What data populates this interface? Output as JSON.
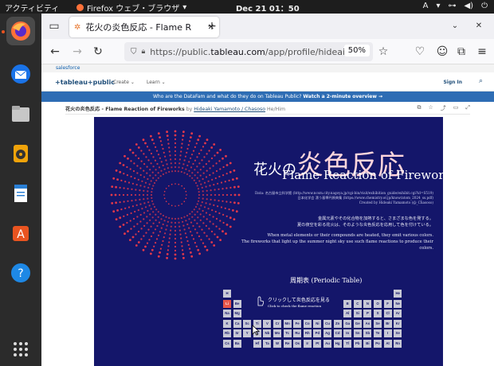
{
  "system": {
    "activities": "アクティビティ",
    "app_name": "Firefox ウェブ・ブラウザ",
    "clock": "Dec 21  01：50",
    "input_method": "A"
  },
  "browser": {
    "tab_title": "花火の炎色反応 - Flame R",
    "url_prefix": "https://public.",
    "url_host": "tableau.com",
    "url_path": "/app/profile/hideai",
    "zoom": "50%"
  },
  "site": {
    "salesforce": "salesforce",
    "logo": "+tableau+public",
    "menu_create": "Create ⌄",
    "menu_learn": "Learn ⌄",
    "sign_in": "Sign In",
    "banner_text": "Who are the DataFam and what do they do on Tableau Public?",
    "banner_link": "Watch a 2-minute overview →",
    "viz_title": "花火の炎色反応 - Flame Reaction of Fireworks",
    "by": "by",
    "author": "Hideaki Yamamoto / Chasoso",
    "author_tag": "He/Him"
  },
  "viz": {
    "title_jp_small": "花火の",
    "title_jp_big": "炎色反応",
    "title_en": "Flame Reaction of Fireworks",
    "source_lines": [
      "Data: 名古屋市立科学館 (http://www.ncsm.city.nagoya.jp/cgi-bin/visit/exhibition_guide/exhibit.cgi?id=S519)",
      "日本化学会 漂う基準円原典集 (https://www.chemistry.or.jp/know/atom_2024_ss.pdf)",
      "Created by Hideaki Yamamoto (@_Chasoso)"
    ],
    "desc_lines": [
      "金属元素やその化合物を加熱すると、さまざまな色を発する。",
      "夏の夜空を彩る花火は、そのような炎色反応を応用して色を付けている。",
      "When metal elements or their compounds are heated, they emit various colors.",
      "The fireworks that light up the summer night sky use such flame reactions to produce their colors."
    ],
    "periodic_title": "周期表 (Periodic Table)",
    "click_jp": "クリックして炎色反応を見る",
    "click_en": "Click to check the flame reaction",
    "firework_color": "#e83a4a",
    "background_color": "#14166a",
    "elements": {
      "row1": [
        "H",
        "",
        "He"
      ],
      "row2_left": [
        "Li",
        "Be"
      ],
      "row2_right": [
        "B",
        "C",
        "N",
        "O",
        "F",
        "Ne"
      ],
      "row3_left": [
        "Na",
        "Mg"
      ],
      "row3_right": [
        "Al",
        "Si",
        "P",
        "S",
        "Cl",
        "Ar"
      ],
      "row4": [
        "K",
        "Ca",
        "Sc",
        "Ti",
        "V",
        "Cr",
        "Mn",
        "Fe",
        "Co",
        "Ni",
        "Cu",
        "Zn",
        "Ga",
        "Ge",
        "As",
        "Se",
        "Br",
        "Kr"
      ],
      "row5": [
        "Rb",
        "Sr",
        "Y",
        "Zr",
        "Nb",
        "Mo",
        "Tc",
        "Ru",
        "Rh",
        "Pd",
        "Ag",
        "Cd",
        "In",
        "Sn",
        "Sb",
        "Te",
        "I",
        "Xe"
      ],
      "row6": [
        "Cs",
        "Ba",
        "",
        "Hf",
        "Ta",
        "W",
        "Re",
        "Os",
        "Ir",
        "Pt",
        "Au",
        "Hg",
        "Tl",
        "Pb",
        "Bi",
        "Po",
        "At",
        "Rn"
      ],
      "highlighted": "Li"
    }
  }
}
